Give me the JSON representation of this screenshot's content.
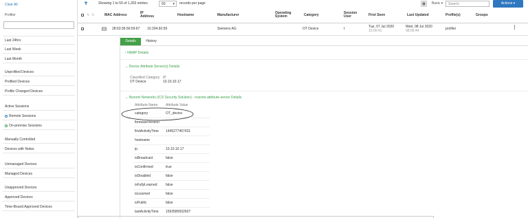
{
  "sidebar": {
    "clear_all": "Clear All",
    "title": "Profiler",
    "search_value": "",
    "items": [
      {
        "label": "Last 24hrs"
      },
      {
        "label": "Last Week"
      },
      {
        "label": "Last Month"
      },
      {
        "label": "Unprofiled Devices"
      },
      {
        "label": "Profiled Devices"
      },
      {
        "label": "Profile Changed Devices"
      },
      {
        "label": "Active Sessions"
      },
      {
        "label": "Remote Sessions"
      },
      {
        "label": "On-premise Sessions"
      },
      {
        "label": "Manually Controlled"
      },
      {
        "label": "Devices with Notes"
      },
      {
        "label": "Unmanaged Devices"
      },
      {
        "label": "Managed Devices"
      },
      {
        "label": "Unapproved Devices"
      },
      {
        "label": "Approved Devices"
      },
      {
        "label": "Time-Bound Approved Devices"
      }
    ]
  },
  "topbar": {
    "showing": "Showing 1 to 50 of 1,303 entries",
    "page_size": "50",
    "records_per_page": "records per page",
    "basic": "Basic ▾",
    "search_placeholder": "Search",
    "actions": "Actions ▾"
  },
  "table": {
    "columns": [
      "MAC Address",
      "IP Address",
      "Hostname",
      "Manufacturer",
      "Operating System",
      "Category",
      "Session User",
      "First Seen",
      "Last Updated",
      "Profile(s)",
      "Groups"
    ],
    "row": {
      "mac": "28:63:36:56:59:67",
      "ip": "10.204.60.59",
      "hostname": "",
      "manufacturer": "Siemens AG",
      "os": "",
      "category": "OT Device",
      "session_user": "t",
      "first_seen_date": "Tue, 07 Jul 2020",
      "first_seen_time": "15:00:41",
      "last_updated_date": "Wed, 08 Jul 2020",
      "last_updated_time": "08:56:44",
      "profile": "profiler"
    }
  },
  "details": {
    "tab_details": "Details",
    "tab_history": "History",
    "nmap_section": "NMAP Details",
    "das_section": "Device Attribute Server(s) Details",
    "das_header_1": "Classified Category",
    "das_header_2": "IP",
    "das_value_1": "OT Device",
    "das_value_2": "10.10.10.17",
    "nozomi_section": "Nozomi Networks (ICS Security Solution) - nozomi-attribute-server Details",
    "attr_header_name": "Attribute Name",
    "attr_header_value": "Attribute Value",
    "attributes": [
      {
        "name": "category",
        "value": "OT_device"
      },
      {
        "name": "firmwareVersion",
        "value": ""
      },
      {
        "name": "firstActivityTime",
        "value": "1445277467431"
      },
      {
        "name": "hostname",
        "value": ""
      },
      {
        "name": "ip",
        "value": "10.10.10.17"
      },
      {
        "name": "isBroadcast",
        "value": "false"
      },
      {
        "name": "isConfirmed",
        "value": "true"
      },
      {
        "name": "isDisabled",
        "value": "false"
      },
      {
        "name": "isFullyLearned",
        "value": "false"
      },
      {
        "name": "isLearned",
        "value": "false"
      },
      {
        "name": "isPublic",
        "value": "false"
      },
      {
        "name": "lastActivityTime",
        "value": "1593580502607"
      }
    ]
  },
  "colors": {
    "accent_blue": "#2f78c0",
    "accent_green": "#43a047"
  }
}
